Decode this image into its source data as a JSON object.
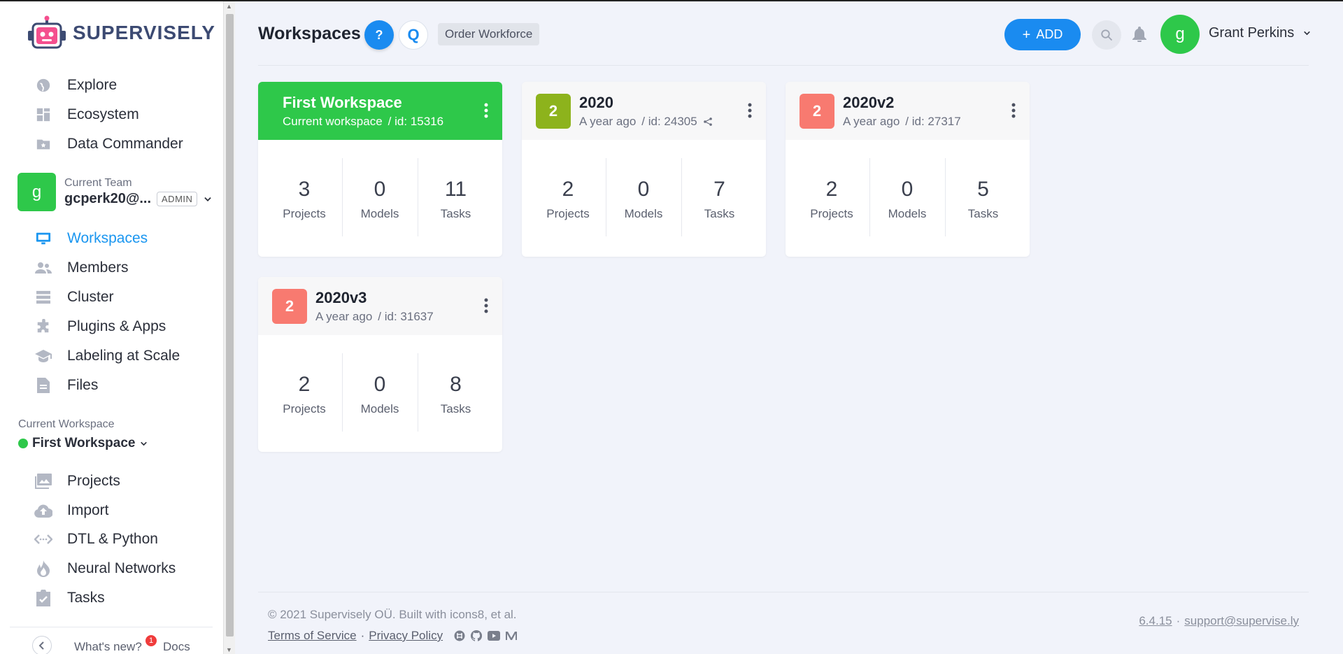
{
  "brand": {
    "name": "SUPERVISELY"
  },
  "sidebar": {
    "top_items": [
      {
        "label": "Explore",
        "icon": "globe-icon"
      },
      {
        "label": "Ecosystem",
        "icon": "ecosystem-icon"
      },
      {
        "label": "Data Commander",
        "icon": "folder-star-icon"
      }
    ],
    "team": {
      "label": "Current Team",
      "avatar_letter": "g",
      "name": "gcperk20@...",
      "role": "ADMIN"
    },
    "team_items": [
      {
        "label": "Workspaces",
        "icon": "monitor-icon",
        "active": true
      },
      {
        "label": "Members",
        "icon": "members-icon"
      },
      {
        "label": "Cluster",
        "icon": "cluster-icon"
      },
      {
        "label": "Plugins & Apps",
        "icon": "puzzle-icon"
      },
      {
        "label": "Labeling at Scale",
        "icon": "graduation-cap-icon"
      },
      {
        "label": "Files",
        "icon": "file-icon"
      }
    ],
    "current_workspace": {
      "label": "Current Workspace",
      "name": "First Workspace"
    },
    "workspace_items": [
      {
        "label": "Projects",
        "icon": "images-icon"
      },
      {
        "label": "Import",
        "icon": "cloud-upload-icon"
      },
      {
        "label": "DTL & Python",
        "icon": "code-icon"
      },
      {
        "label": "Neural Networks",
        "icon": "flame-icon"
      },
      {
        "label": "Tasks",
        "icon": "clipboard-check-icon"
      }
    ],
    "footer": {
      "whats_new": "What's new?",
      "new_count": "1",
      "docs": "Docs"
    }
  },
  "header": {
    "title": "Workspaces",
    "help_label": "?",
    "q_label": "Q",
    "order_label": "Order Workforce",
    "add_label": "ADD",
    "user_avatar_letter": "g",
    "user_name": "Grant Perkins"
  },
  "cards": [
    {
      "badge": "",
      "badge_color": "",
      "title": "First Workspace",
      "subtitle": "Current workspace",
      "id_text": "/ id: 15316",
      "current": true,
      "shared": false,
      "stats": [
        {
          "value": "3",
          "label": "Projects"
        },
        {
          "value": "0",
          "label": "Models"
        },
        {
          "value": "11",
          "label": "Tasks"
        }
      ]
    },
    {
      "badge": "2",
      "badge_color": "#8db31c",
      "title": "2020",
      "subtitle": "A year ago",
      "id_text": "/ id: 24305",
      "current": false,
      "shared": true,
      "stats": [
        {
          "value": "2",
          "label": "Projects"
        },
        {
          "value": "0",
          "label": "Models"
        },
        {
          "value": "7",
          "label": "Tasks"
        }
      ]
    },
    {
      "badge": "2",
      "badge_color": "#f87a70",
      "title": "2020v2",
      "subtitle": "A year ago",
      "id_text": "/ id: 27317",
      "current": false,
      "shared": false,
      "stats": [
        {
          "value": "2",
          "label": "Projects"
        },
        {
          "value": "0",
          "label": "Models"
        },
        {
          "value": "5",
          "label": "Tasks"
        }
      ]
    },
    {
      "badge": "2",
      "badge_color": "#f87a70",
      "title": "2020v3",
      "subtitle": "A year ago",
      "id_text": "/ id: 31637",
      "current": false,
      "shared": false,
      "stats": [
        {
          "value": "2",
          "label": "Projects"
        },
        {
          "value": "0",
          "label": "Models"
        },
        {
          "value": "8",
          "label": "Tasks"
        }
      ]
    }
  ],
  "footer": {
    "copyright": "© 2021 Supervisely OÜ. Built with icons8, et al.",
    "terms": "Terms of Service",
    "separator": "·",
    "privacy": "Privacy Policy",
    "version": "6.4.15",
    "support": "support@supervise.ly"
  },
  "colors": {
    "accent": "#1a8bf0",
    "green": "#2ec84a",
    "background": "#f1f3fa"
  }
}
